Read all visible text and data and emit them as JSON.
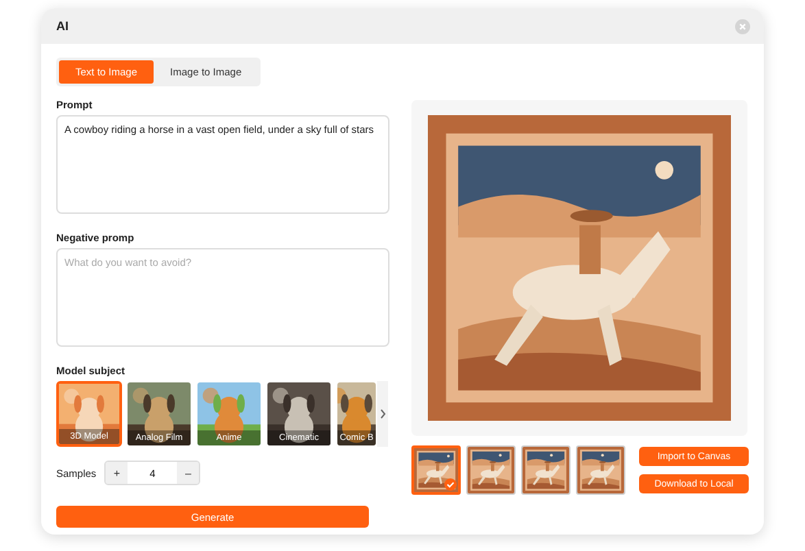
{
  "window": {
    "title": "AI"
  },
  "tabs": [
    {
      "label": "Text to Image",
      "selected": true
    },
    {
      "label": "Image to Image",
      "selected": false
    }
  ],
  "prompt": {
    "label": "Prompt",
    "value": "A cowboy riding a horse in a vast open field, under a sky full of stars"
  },
  "negative_prompt": {
    "label": "Negative promp",
    "placeholder": "What do you want to avoid?"
  },
  "model_subject": {
    "label": "Model subject",
    "models": [
      {
        "name": "3D Model",
        "selected": true
      },
      {
        "name": "Analog Film",
        "selected": false
      },
      {
        "name": "Anime",
        "selected": false
      },
      {
        "name": "Cinematic",
        "selected": false
      },
      {
        "name": "Comic B",
        "selected": false
      }
    ]
  },
  "samples": {
    "label": "Samples",
    "increment": "+",
    "value": "4",
    "decrement": "–"
  },
  "generate": "Generate",
  "preview": {
    "kind": "picture"
  },
  "results": [
    {
      "kind": "picture",
      "selected": true
    },
    {
      "kind": "picture",
      "selected": false
    },
    {
      "kind": "picture",
      "selected": false
    },
    {
      "kind": "picture",
      "selected": false
    }
  ],
  "actions": [
    "Import to Canvas",
    "Download to Local"
  ]
}
